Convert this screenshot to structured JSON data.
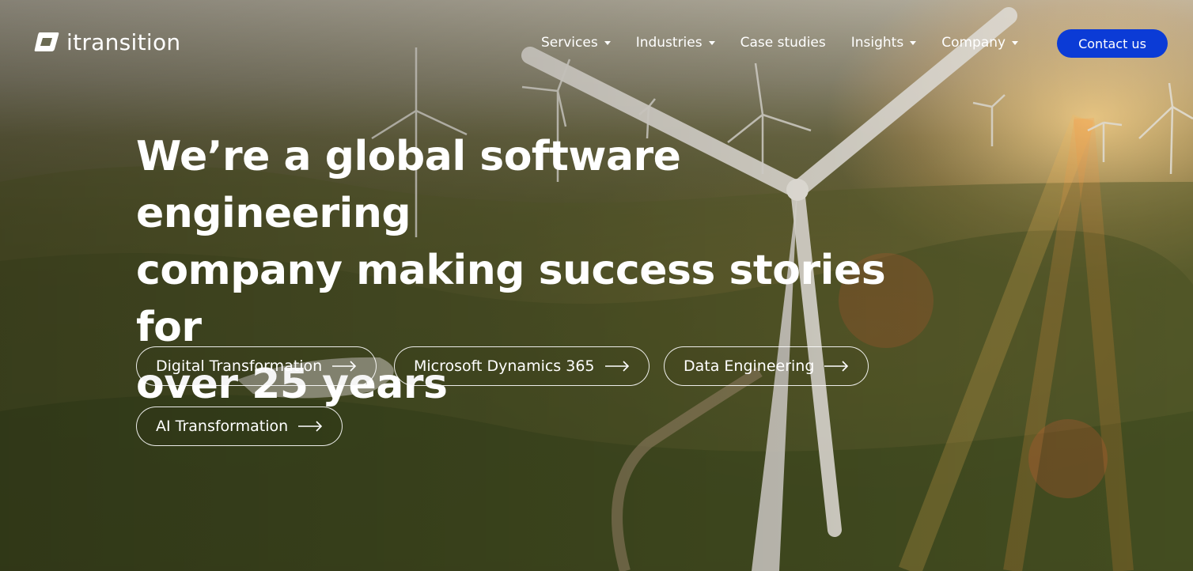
{
  "brand": {
    "name": "itransition"
  },
  "nav": {
    "items": [
      {
        "label": "Services",
        "has_dropdown": true
      },
      {
        "label": "Industries",
        "has_dropdown": true
      },
      {
        "label": "Case studies",
        "has_dropdown": false
      },
      {
        "label": "Insights",
        "has_dropdown": true
      },
      {
        "label": "Company",
        "has_dropdown": true
      }
    ],
    "contact_label": "Contact us"
  },
  "hero": {
    "headline_lines": [
      "We’re a global software engineering",
      "company making success stories for",
      "over 25 years"
    ],
    "pills": [
      {
        "label": "Digital Transformation",
        "icon": "arrow-right-icon"
      },
      {
        "label": "Microsoft Dynamics 365",
        "icon": "arrow-right-icon"
      },
      {
        "label": "Data Engineering",
        "icon": "arrow-right-icon"
      },
      {
        "label": "AI Transformation",
        "icon": "arrow-right-icon"
      }
    ]
  },
  "colors": {
    "accent": "#0b3bd6",
    "text": "#ffffff"
  }
}
